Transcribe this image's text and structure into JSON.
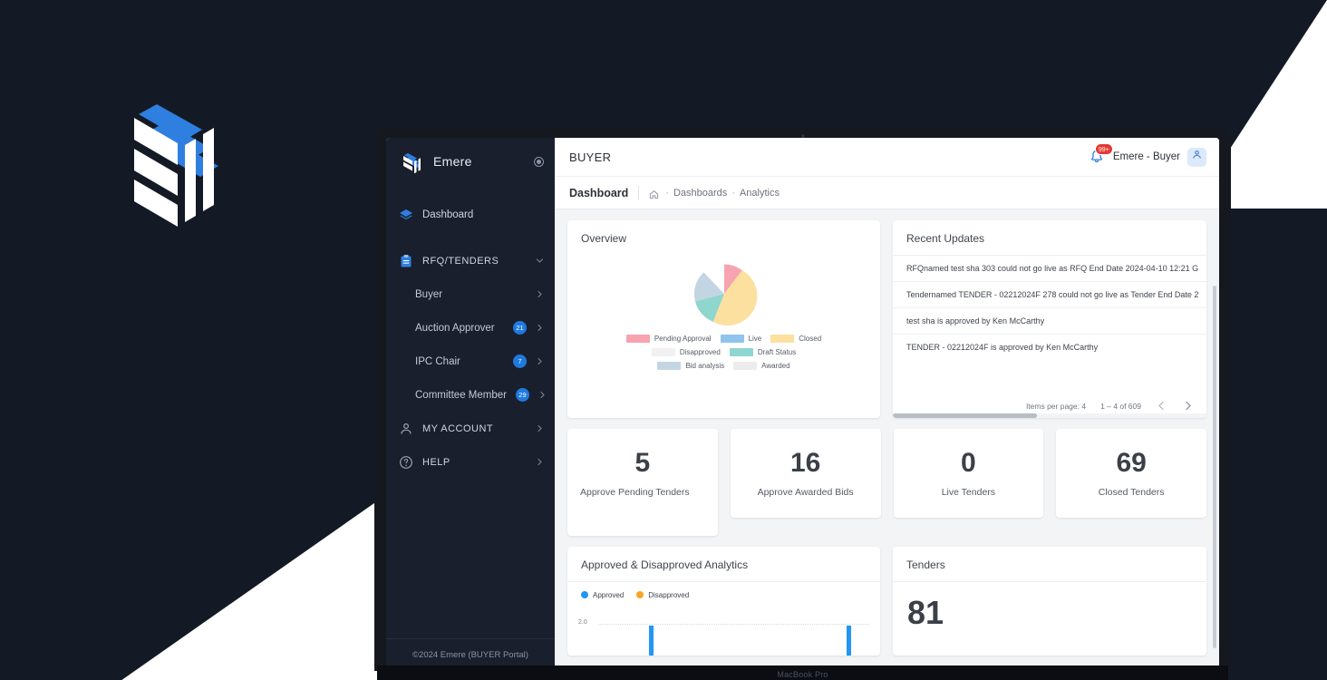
{
  "brand": {
    "logo_icon": "emere-cube-logo",
    "device_label": "MacBook Pro"
  },
  "sidebar": {
    "brand_name": "Emere",
    "collapse_icon": "target-dot-icon",
    "logo_icon": "emere-cube-logo",
    "items": [
      {
        "label": "Dashboard",
        "icon": "layers-icon",
        "badge": "",
        "chevron": ""
      },
      {
        "label": "RFQ/TENDERS",
        "icon": "clipboard-icon",
        "badge": "",
        "chevron": "chevron-down-icon"
      },
      {
        "label": "Buyer",
        "icon": "",
        "badge": "",
        "chevron": "chevron-right-icon"
      },
      {
        "label": "Auction Approver",
        "icon": "",
        "badge": "21",
        "chevron": "chevron-right-icon"
      },
      {
        "label": "IPC Chair",
        "icon": "",
        "badge": "7",
        "chevron": "chevron-right-icon"
      },
      {
        "label": "Committee Member",
        "icon": "",
        "badge": "29",
        "chevron": "chevron-right-icon"
      },
      {
        "label": "MY ACCOUNT",
        "icon": "person-icon",
        "badge": "",
        "chevron": "chevron-right-icon"
      },
      {
        "label": "HELP",
        "icon": "question-circle-icon",
        "badge": "",
        "chevron": "chevron-right-icon"
      }
    ],
    "footer": "©2024 Emere (BUYER Portal)",
    "badge_color": "#1f7ae0"
  },
  "topbar": {
    "title": "BUYER",
    "bell_icon": "bell-icon",
    "notification_count": "99+",
    "notification_color": "#e53935",
    "user_name": "Emere - Buyer",
    "avatar_icon": "person-icon"
  },
  "breadcrumb": {
    "page": "Dashboard",
    "home_icon": "home-icon",
    "items": [
      "Dashboards",
      "Analytics"
    ],
    "separator": "·"
  },
  "overview": {
    "title": "Overview"
  },
  "chart_data": [
    {
      "type": "pie",
      "title": "Overview",
      "legend_position": "bottom",
      "categories": [
        "Pending Approval",
        "Live",
        "Closed",
        "Disapproved",
        "Draft Status",
        "Bid analysis",
        "Awarded"
      ],
      "values": [
        8,
        0,
        45,
        0,
        14,
        22,
        0
      ],
      "colors": [
        "#f8a3b0",
        "#8fc4ec",
        "#fbe0a0",
        "#f1f1f1",
        "#8fd6ce",
        "#c3d5e2",
        "#ececec"
      ]
    },
    {
      "type": "bar",
      "title": "Approved & Disapproved Analytics",
      "series": [
        {
          "name": "Approved",
          "color": "#2196f3",
          "values": [
            0,
            0,
            2,
            0,
            0,
            0,
            0,
            0,
            0,
            0,
            0,
            2,
            0
          ]
        },
        {
          "name": "Disapproved",
          "color": "#f5a623",
          "values": [
            0,
            0,
            0,
            0,
            0,
            0,
            0,
            0,
            0,
            0,
            0,
            0,
            0
          ]
        }
      ],
      "ylabel": "",
      "xlabel": "",
      "yticks": [
        "2.0"
      ],
      "ylim": [
        0,
        2.0
      ],
      "grid": true,
      "legend_position": "top"
    }
  ],
  "updates": {
    "title": "Recent Updates",
    "items": [
      "RFQnamed test sha 303 could not go live as RFQ End Date 2024-04-10 12:21 G",
      "Tendernamed TENDER - 02212024F 278 could not go live as Tender End Date 2",
      "test sha is approved by Ken McCarthy",
      "TENDER - 02212024F is approved by Ken McCarthy"
    ],
    "items_per_page_label": "Items per page: 4",
    "range_label": "1 – 4 of 609",
    "prev_icon": "chevron-left-icon",
    "next_icon": "chevron-right-icon"
  },
  "stats": [
    {
      "value": "5",
      "label": "Approve Pending Tenders"
    },
    {
      "value": "16",
      "label": "Approve Awarded Bids"
    },
    {
      "value": "0",
      "label": "Live Tenders"
    },
    {
      "value": "69",
      "label": "Closed Tenders"
    }
  ],
  "analytics": {
    "title": "Approved & Disapproved Analytics",
    "legend": [
      {
        "label": "Approved",
        "color": "#2196f3"
      },
      {
        "label": "Disapproved",
        "color": "#f5a623"
      }
    ],
    "ytick": "2.0"
  },
  "tenders": {
    "title": "Tenders",
    "value": "81"
  }
}
